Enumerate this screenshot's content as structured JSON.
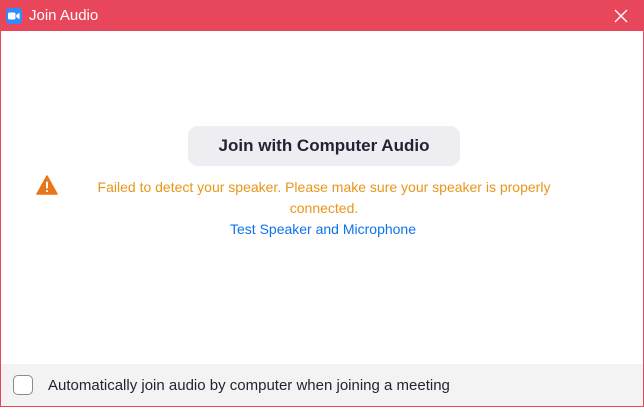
{
  "window": {
    "title": "Join Audio",
    "app_icon": "zoom-camera-icon",
    "close_icon": "close-icon",
    "accent_color": "#e8465a"
  },
  "main": {
    "join_button_label": "Join with Computer Audio",
    "warning_icon": "warning-triangle-icon",
    "warning_color": "#e8961a",
    "warning_line1": "Failed to detect your speaker. Please make sure your speaker is properly",
    "warning_line2": "connected.",
    "test_link_label": "Test Speaker and Microphone",
    "link_color": "#0e72ed"
  },
  "footer": {
    "checkbox_checked": false,
    "checkbox_label": "Automatically join audio by computer when joining a meeting"
  }
}
